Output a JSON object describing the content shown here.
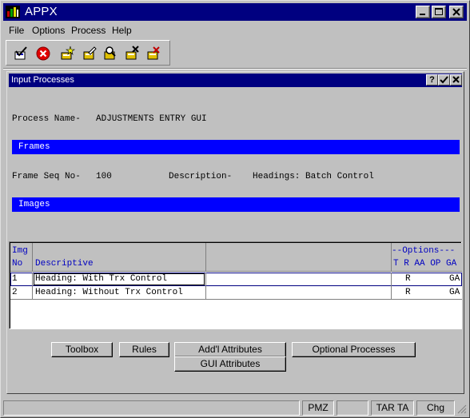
{
  "app": {
    "title": "APPX",
    "icon": "appx-logo-icon"
  },
  "caption_buttons": [
    "minimize-icon",
    "maximize-icon",
    "close-icon"
  ],
  "menu": [
    {
      "label": "File"
    },
    {
      "label": "Options"
    },
    {
      "label": "Process"
    },
    {
      "label": "Help"
    }
  ],
  "toolbar": [
    "ok-check-icon",
    "cancel-x-icon",
    "add-star-icon",
    "change-edit-icon",
    "inquire-magnifier-icon",
    "delete-x-icon",
    "review-icon"
  ],
  "child": {
    "title": "Input Processes",
    "buttons": [
      "help-question-icon",
      "check-icon",
      "close-icon"
    ],
    "process_label": "Process Name-",
    "process_value": "ADJUSTMENTS ENTRY GUI",
    "frames_header": "Frames",
    "frame_seq_label": "Frame Seq No-",
    "frame_seq_value": "100",
    "description_label": "Description-",
    "description_value": "Headings: Batch Control",
    "images_header": "Images"
  },
  "table": {
    "headers": {
      "img_line1": "Img",
      "img_line2": "No",
      "descriptive": "Descriptive",
      "options_title": "--Options---",
      "options_cols": "T R AA OP GA"
    },
    "rows": [
      {
        "no": "1",
        "descriptive": "Heading: With Trx Control",
        "r": "R",
        "ga": "GA"
      },
      {
        "no": "2",
        "descriptive": "Heading: Without Trx Control",
        "r": "R",
        "ga": "GA"
      }
    ]
  },
  "buttons": {
    "toolbox": "Toolbox",
    "rules": "Rules",
    "addl_attributes": "Add'l Attributes",
    "optional_processes": "Optional Processes",
    "gui_attributes": "GUI Attributes"
  },
  "status": {
    "s1": "",
    "s2": "PMZ",
    "s3": "",
    "s4": "TAR TA",
    "s5": "Chg"
  },
  "colors": {
    "titlebar": "#000080",
    "section_bar": "#0000ff",
    "header_text": "#0000c0"
  }
}
